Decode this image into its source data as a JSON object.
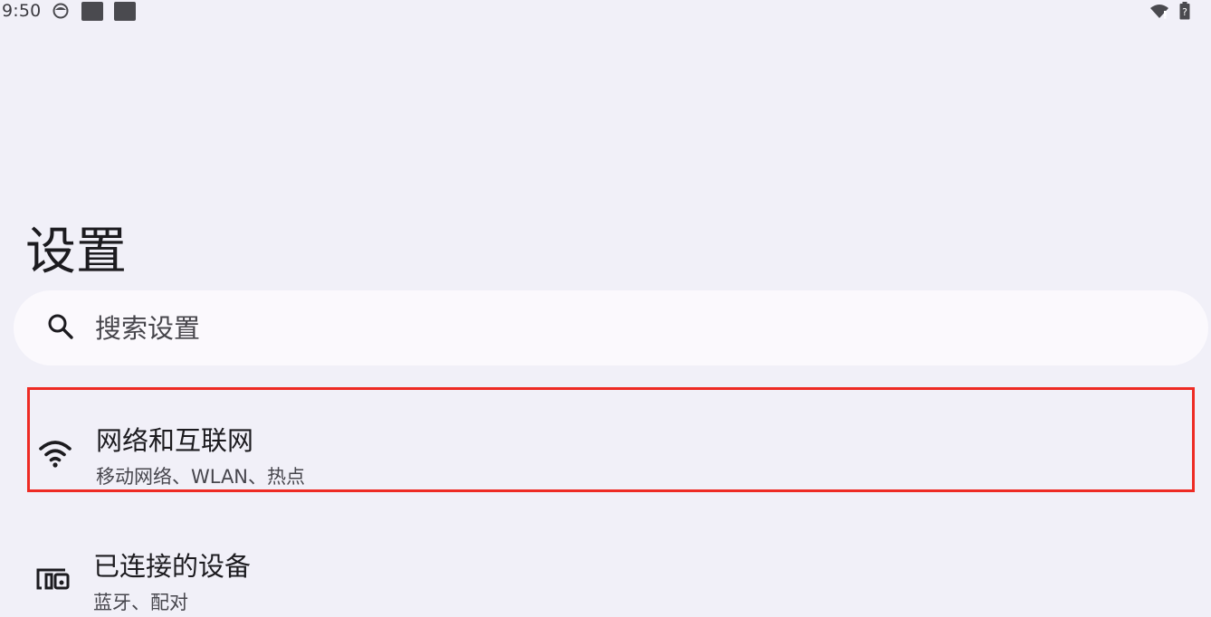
{
  "status_bar": {
    "time": "9:50",
    "icons": [
      "app-notification-icon",
      "notification-square-icon",
      "notification-square-icon",
      "wifi-icon",
      "battery-icon"
    ]
  },
  "page": {
    "title": "设置"
  },
  "search": {
    "placeholder": "搜索设置",
    "icon": "search-icon"
  },
  "settings": [
    {
      "icon": "wifi-icon",
      "title": "网络和互联网",
      "summary": "移动网络、WLAN、热点",
      "highlight_color": "#ee2b24"
    },
    {
      "icon": "connected-devices-icon",
      "title": "已连接的设备",
      "summary": "蓝牙、配对"
    }
  ],
  "colors": {
    "background": "#f1f0f8",
    "search_background": "#fbf9fd",
    "primary_text": "#1c1b1f",
    "secondary_text": "#47464d"
  }
}
